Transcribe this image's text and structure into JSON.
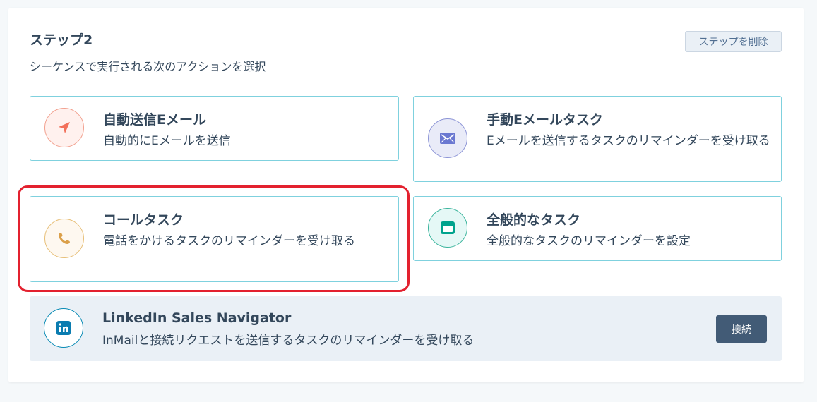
{
  "step": {
    "title": "ステップ2",
    "subtitle": "シーケンスで実行される次のアクションを選択",
    "delete_label": "ステップを削除"
  },
  "cards": {
    "auto_email": {
      "title": "自動送信Eメール",
      "description": "自動的にEメールを送信",
      "icon": "paper-plane-icon",
      "color": "#f2705a"
    },
    "manual_email": {
      "title": "手動Eメールタスク",
      "description": "Eメールを送信するタスクのリマインダーを受け取る",
      "icon": "envelope-icon",
      "color": "#6a78d1"
    },
    "call": {
      "title": "コールタスク",
      "description": "電話をかけるタスクのリマインダーを受け取る",
      "icon": "phone-icon",
      "color": "#dba04a"
    },
    "general": {
      "title": "全般的なタスク",
      "description": "全般的なタスクのリマインダーを設定",
      "icon": "task-icon",
      "color": "#00a38d"
    }
  },
  "linkedin": {
    "title": "LinkedIn Sales Navigator",
    "description": "InMailと接続リクエストを送信するタスクのリマインダーを受け取る",
    "connect_label": "接続",
    "icon": "linkedin-icon",
    "color": "#0a7cb0"
  },
  "colors": {
    "card_border": "#7fd1de",
    "highlight": "#e3212f",
    "primary_button": "#425b76"
  }
}
